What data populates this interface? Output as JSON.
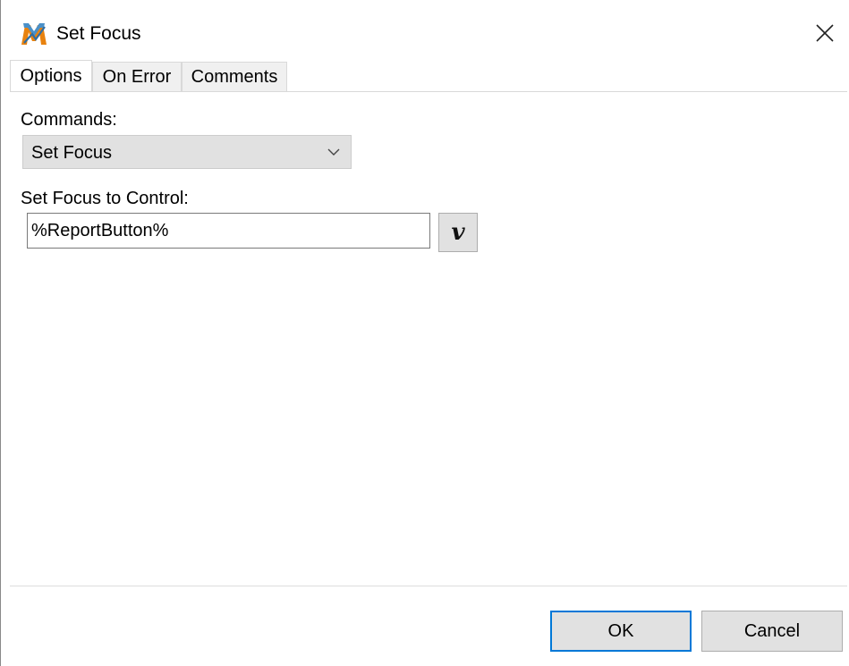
{
  "window": {
    "title": "Set Focus",
    "icon": "macro-app-icon",
    "close_icon": "close-icon"
  },
  "tabs": [
    {
      "label": "Options",
      "active": true
    },
    {
      "label": "On Error",
      "active": false
    },
    {
      "label": "Comments",
      "active": false
    }
  ],
  "options": {
    "commands_label": "Commands:",
    "commands_value": "Set Focus",
    "target_label": "Set Focus to Control:",
    "target_value": "%ReportButton%",
    "variable_button_glyph": "v"
  },
  "footer": {
    "ok_label": "OK",
    "cancel_label": "Cancel"
  },
  "colors": {
    "accent": "#0078d7",
    "button_face": "#e1e1e1"
  }
}
